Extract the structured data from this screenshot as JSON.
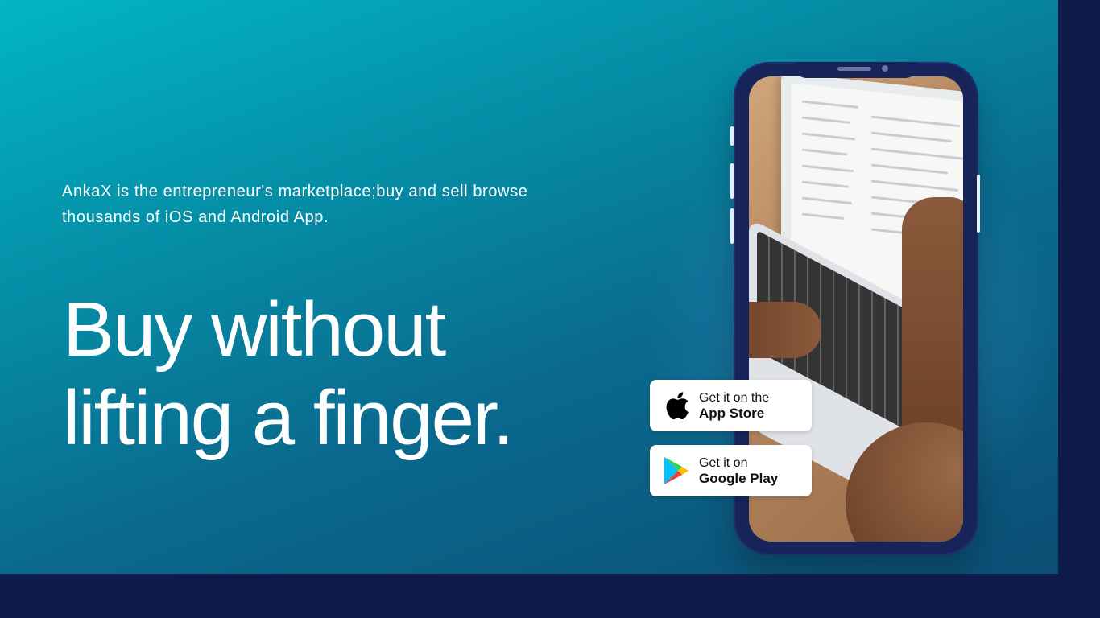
{
  "hero": {
    "tagline": "AnkaX is the entrepreneur's marketplace;buy and sell browse thousands of iOS and Android App.",
    "headline_line1": "Buy without",
    "headline_line2": "lifting a finger."
  },
  "badges": {
    "app_store": {
      "small": "Get it on the",
      "big": "App Store",
      "icon": "apple-icon"
    },
    "google_play": {
      "small": "Get it on",
      "big": "Google Play",
      "icon": "google-play-icon"
    }
  },
  "colors": {
    "background_dark": "#0e1b4a",
    "gradient_start": "#02b6c2",
    "gradient_end": "#0c4e74",
    "phone_frame": "#16245a"
  }
}
